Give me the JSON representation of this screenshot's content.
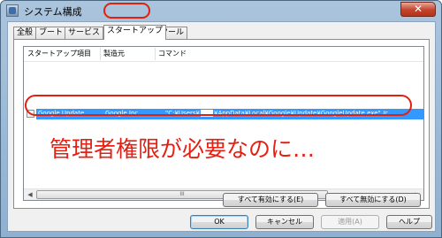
{
  "window": {
    "title": "システム構成",
    "close_glyph": "✕"
  },
  "tabs": [
    {
      "label": "全般",
      "active": false
    },
    {
      "label": "ブート",
      "active": false
    },
    {
      "label": "サービス",
      "active": false
    },
    {
      "label": "スタートアップ",
      "active": true
    },
    {
      "label": "ツール",
      "active": false
    }
  ],
  "startup_list": {
    "columns": [
      "スタートアップ項目",
      "製造元",
      "コマンド"
    ],
    "rows": [
      {
        "checked": false,
        "item": "Google Update",
        "manufacturer": "Google Inc.",
        "command_prefix": "\"C:¥Users¥",
        "command_suffix": "¥AppData¥Local¥Google¥Update¥GoogleUpdate.exe\" /c",
        "selected": true
      }
    ]
  },
  "annotation": {
    "text": "管理者権限が必要なのに…",
    "color": "#e52013"
  },
  "scrollbar": {
    "left_arrow": "◀",
    "right_arrow": "▶",
    "grip": "III"
  },
  "actions": {
    "enable_all": "すべて有効にする(E)",
    "disable_all": "すべて無効にする(D)"
  },
  "dialog_buttons": {
    "ok": "OK",
    "cancel": "キャンセル",
    "apply": "適用(A)",
    "help": "ヘルプ"
  }
}
